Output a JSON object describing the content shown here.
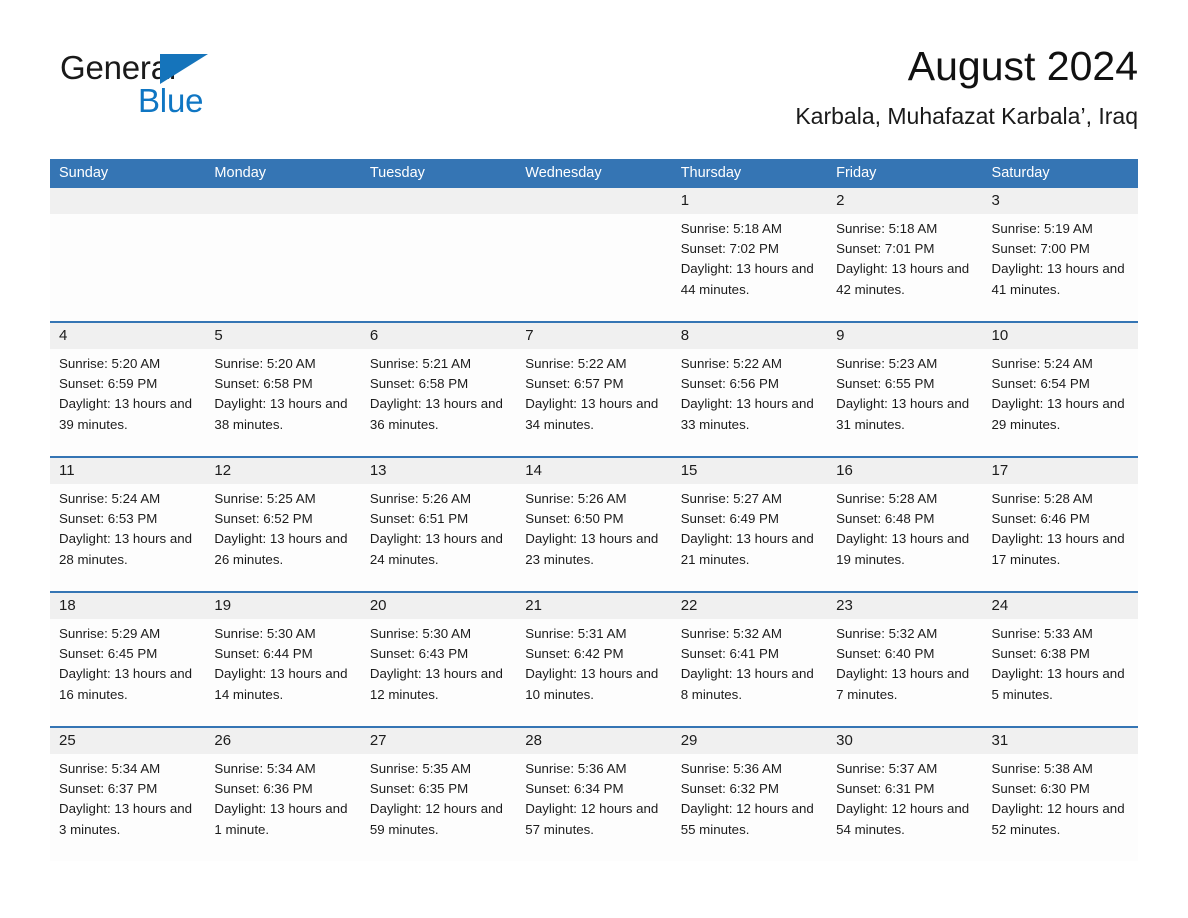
{
  "brand": {
    "name_part1": "General",
    "name_part2": "Blue",
    "triangle_color": "#1574bb",
    "blue_text_color": "#0f76c3"
  },
  "header": {
    "title": "August 2024",
    "location": "Karbala, Muhafazat Karbala’, Iraq"
  },
  "theme": {
    "header_blue": "#3575b4",
    "daynum_band_gray": "#f0f0f0",
    "row_divider_blue": "#3575b4",
    "text_color": "#1c1c1c"
  },
  "calendar": {
    "weekday_headers": [
      "Sunday",
      "Monday",
      "Tuesday",
      "Wednesday",
      "Thursday",
      "Friday",
      "Saturday"
    ],
    "weeks": [
      [
        {
          "day": "",
          "empty": true
        },
        {
          "day": "",
          "empty": true
        },
        {
          "day": "",
          "empty": true
        },
        {
          "day": "",
          "empty": true
        },
        {
          "day": "1",
          "sunrise": "Sunrise: 5:18 AM",
          "sunset": "Sunset: 7:02 PM",
          "daylight": "Daylight: 13 hours and 44 minutes."
        },
        {
          "day": "2",
          "sunrise": "Sunrise: 5:18 AM",
          "sunset": "Sunset: 7:01 PM",
          "daylight": "Daylight: 13 hours and 42 minutes."
        },
        {
          "day": "3",
          "sunrise": "Sunrise: 5:19 AM",
          "sunset": "Sunset: 7:00 PM",
          "daylight": "Daylight: 13 hours and 41 minutes."
        }
      ],
      [
        {
          "day": "4",
          "sunrise": "Sunrise: 5:20 AM",
          "sunset": "Sunset: 6:59 PM",
          "daylight": "Daylight: 13 hours and 39 minutes."
        },
        {
          "day": "5",
          "sunrise": "Sunrise: 5:20 AM",
          "sunset": "Sunset: 6:58 PM",
          "daylight": "Daylight: 13 hours and 38 minutes."
        },
        {
          "day": "6",
          "sunrise": "Sunrise: 5:21 AM",
          "sunset": "Sunset: 6:58 PM",
          "daylight": "Daylight: 13 hours and 36 minutes."
        },
        {
          "day": "7",
          "sunrise": "Sunrise: 5:22 AM",
          "sunset": "Sunset: 6:57 PM",
          "daylight": "Daylight: 13 hours and 34 minutes."
        },
        {
          "day": "8",
          "sunrise": "Sunrise: 5:22 AM",
          "sunset": "Sunset: 6:56 PM",
          "daylight": "Daylight: 13 hours and 33 minutes."
        },
        {
          "day": "9",
          "sunrise": "Sunrise: 5:23 AM",
          "sunset": "Sunset: 6:55 PM",
          "daylight": "Daylight: 13 hours and 31 minutes."
        },
        {
          "day": "10",
          "sunrise": "Sunrise: 5:24 AM",
          "sunset": "Sunset: 6:54 PM",
          "daylight": "Daylight: 13 hours and 29 minutes."
        }
      ],
      [
        {
          "day": "11",
          "sunrise": "Sunrise: 5:24 AM",
          "sunset": "Sunset: 6:53 PM",
          "daylight": "Daylight: 13 hours and 28 minutes."
        },
        {
          "day": "12",
          "sunrise": "Sunrise: 5:25 AM",
          "sunset": "Sunset: 6:52 PM",
          "daylight": "Daylight: 13 hours and 26 minutes."
        },
        {
          "day": "13",
          "sunrise": "Sunrise: 5:26 AM",
          "sunset": "Sunset: 6:51 PM",
          "daylight": "Daylight: 13 hours and 24 minutes."
        },
        {
          "day": "14",
          "sunrise": "Sunrise: 5:26 AM",
          "sunset": "Sunset: 6:50 PM",
          "daylight": "Daylight: 13 hours and 23 minutes."
        },
        {
          "day": "15",
          "sunrise": "Sunrise: 5:27 AM",
          "sunset": "Sunset: 6:49 PM",
          "daylight": "Daylight: 13 hours and 21 minutes."
        },
        {
          "day": "16",
          "sunrise": "Sunrise: 5:28 AM",
          "sunset": "Sunset: 6:48 PM",
          "daylight": "Daylight: 13 hours and 19 minutes."
        },
        {
          "day": "17",
          "sunrise": "Sunrise: 5:28 AM",
          "sunset": "Sunset: 6:46 PM",
          "daylight": "Daylight: 13 hours and 17 minutes."
        }
      ],
      [
        {
          "day": "18",
          "sunrise": "Sunrise: 5:29 AM",
          "sunset": "Sunset: 6:45 PM",
          "daylight": "Daylight: 13 hours and 16 minutes."
        },
        {
          "day": "19",
          "sunrise": "Sunrise: 5:30 AM",
          "sunset": "Sunset: 6:44 PM",
          "daylight": "Daylight: 13 hours and 14 minutes."
        },
        {
          "day": "20",
          "sunrise": "Sunrise: 5:30 AM",
          "sunset": "Sunset: 6:43 PM",
          "daylight": "Daylight: 13 hours and 12 minutes."
        },
        {
          "day": "21",
          "sunrise": "Sunrise: 5:31 AM",
          "sunset": "Sunset: 6:42 PM",
          "daylight": "Daylight: 13 hours and 10 minutes."
        },
        {
          "day": "22",
          "sunrise": "Sunrise: 5:32 AM",
          "sunset": "Sunset: 6:41 PM",
          "daylight": "Daylight: 13 hours and 8 minutes."
        },
        {
          "day": "23",
          "sunrise": "Sunrise: 5:32 AM",
          "sunset": "Sunset: 6:40 PM",
          "daylight": "Daylight: 13 hours and 7 minutes."
        },
        {
          "day": "24",
          "sunrise": "Sunrise: 5:33 AM",
          "sunset": "Sunset: 6:38 PM",
          "daylight": "Daylight: 13 hours and 5 minutes."
        }
      ],
      [
        {
          "day": "25",
          "sunrise": "Sunrise: 5:34 AM",
          "sunset": "Sunset: 6:37 PM",
          "daylight": "Daylight: 13 hours and 3 minutes."
        },
        {
          "day": "26",
          "sunrise": "Sunrise: 5:34 AM",
          "sunset": "Sunset: 6:36 PM",
          "daylight": "Daylight: 13 hours and 1 minute."
        },
        {
          "day": "27",
          "sunrise": "Sunrise: 5:35 AM",
          "sunset": "Sunset: 6:35 PM",
          "daylight": "Daylight: 12 hours and 59 minutes."
        },
        {
          "day": "28",
          "sunrise": "Sunrise: 5:36 AM",
          "sunset": "Sunset: 6:34 PM",
          "daylight": "Daylight: 12 hours and 57 minutes."
        },
        {
          "day": "29",
          "sunrise": "Sunrise: 5:36 AM",
          "sunset": "Sunset: 6:32 PM",
          "daylight": "Daylight: 12 hours and 55 minutes."
        },
        {
          "day": "30",
          "sunrise": "Sunrise: 5:37 AM",
          "sunset": "Sunset: 6:31 PM",
          "daylight": "Daylight: 12 hours and 54 minutes."
        },
        {
          "day": "31",
          "sunrise": "Sunrise: 5:38 AM",
          "sunset": "Sunset: 6:30 PM",
          "daylight": "Daylight: 12 hours and 52 minutes."
        }
      ]
    ]
  }
}
